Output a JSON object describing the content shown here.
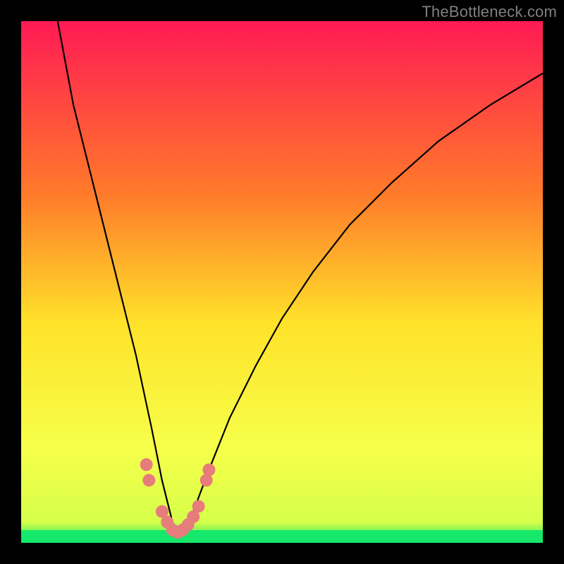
{
  "watermark": "TheBottleneck.com",
  "colors": {
    "bg": "#000000",
    "grad_top": "#ff1a54",
    "grad_mid1": "#ff7a2a",
    "grad_mid2": "#ffe22a",
    "grad_mid3": "#f6ff4a",
    "grad_bottom": "#15e86a",
    "curve": "#000000",
    "marker": "#e77c7c"
  },
  "chart_data": {
    "type": "line",
    "title": "",
    "xlabel": "",
    "ylabel": "",
    "xlim": [
      0,
      100
    ],
    "ylim": [
      0,
      100
    ],
    "optimum_x": 30,
    "series": [
      {
        "name": "bottleneck-curve",
        "x": [
          7,
          10,
          14,
          18,
          22,
          25,
          27,
          29,
          30,
          31,
          33,
          36,
          40,
          45,
          50,
          56,
          63,
          71,
          80,
          90,
          100
        ],
        "values": [
          100,
          84,
          68,
          52,
          36,
          22,
          12,
          4,
          1,
          2,
          6,
          14,
          24,
          34,
          43,
          52,
          61,
          69,
          77,
          84,
          90
        ]
      }
    ],
    "markers": {
      "name": "highlight-points",
      "x": [
        24,
        24.5,
        27,
        28,
        29,
        30,
        31,
        32,
        33,
        34,
        35.5,
        36
      ],
      "values": [
        15,
        12,
        6,
        4,
        2.5,
        2,
        2.5,
        3.5,
        5,
        7,
        12,
        14
      ]
    }
  }
}
